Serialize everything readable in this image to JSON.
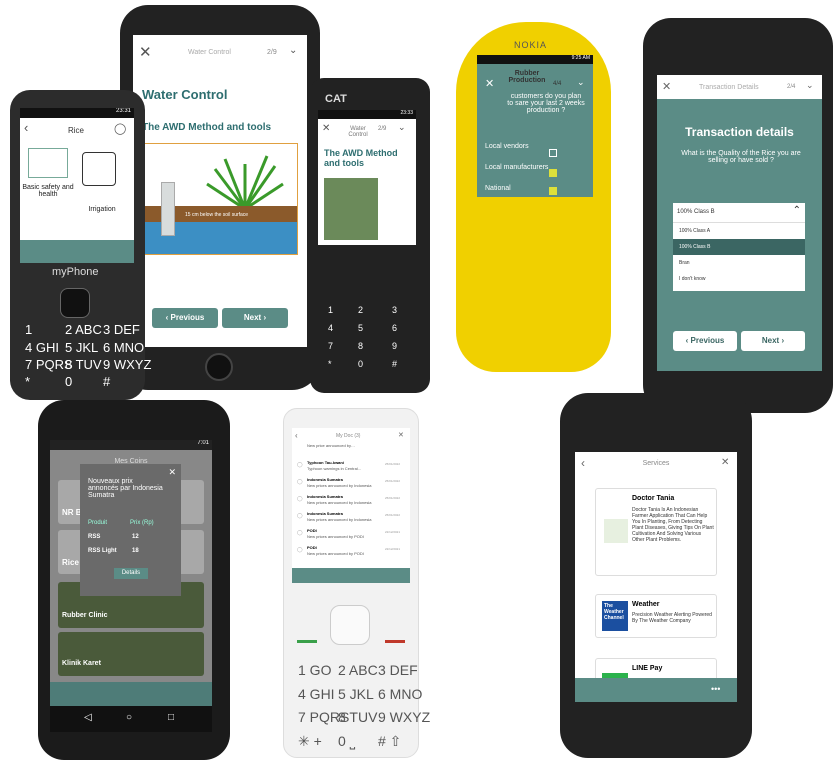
{
  "water": {
    "title": "Water Control",
    "page": "2/9",
    "heading": "Water Control",
    "subheading": "The AWD Method and tools",
    "depth_label": "15 cm below the soil surface",
    "prev": "Previous",
    "next": "Next"
  },
  "myphone": {
    "time": "23:31",
    "app": "Rice",
    "item1": "Basic safety and health",
    "item2": "Irrigation",
    "brand": "myPhone",
    "keys": [
      "1",
      "2 ABC",
      "3 DEF",
      "4 GHI",
      "5 JKL",
      "6 MNO",
      "7 PQRS",
      "8 TUV",
      "9 WXYZ",
      "*",
      "0",
      "#"
    ]
  },
  "cat": {
    "brand": "CAT",
    "time": "23:33",
    "title": "Water Control",
    "page": "2/9",
    "heading": "The AWD Method and tools",
    "keys": [
      "1",
      "2",
      "3",
      "4",
      "5",
      "6",
      "7",
      "8",
      "9",
      "*",
      "0",
      "#"
    ]
  },
  "nokia": {
    "brand": "NOKIA",
    "time": "9:25 AM",
    "title": "Rubber Production",
    "page": "4/4",
    "question": "customers do you plan to sare your last 2 weeks production ?",
    "options": [
      "Local vendors",
      "Local manufacturers",
      "National"
    ]
  },
  "transaction": {
    "title": "Transaction Details",
    "page": "2/4",
    "heading": "Transaction details",
    "question": "What is the Quality of the Rice you are selling or have sold ?",
    "selected": "100% Class B",
    "options": [
      "100% Class A",
      "100% Class B",
      "Bran",
      "I don't know"
    ],
    "prev": "Previous",
    "next": "Next"
  },
  "mycoins": {
    "time": "7:01",
    "title": "Mes Coins",
    "popup_text": "Nouveaux prix annoncés par Indonesia Sumatra",
    "col1": "Produit",
    "col2": "Prix (Rp)",
    "rows": [
      {
        "product": "RSS",
        "price": "12"
      },
      {
        "product": "RSS Light",
        "price": "18"
      }
    ],
    "details": "Details",
    "cards": [
      "NR B",
      "Rice",
      "Rubber Clinic",
      "Klinik Karet"
    ]
  },
  "feature": {
    "title": "My Doc (3)",
    "items": [
      {
        "title": "",
        "sub": "New price announced by…",
        "date": ""
      },
      {
        "title": "Typhoon Tau-kwani",
        "sub": "Typhoon warnings in Central...",
        "date": "25/01/2022"
      },
      {
        "title": "Indonesia Sumatra",
        "sub": "New prices announced by Indonesia",
        "date": "25/01/2022"
      },
      {
        "title": "Indonesia Sumatra",
        "sub": "New prices announced by Indonesia",
        "date": "25/01/2022"
      },
      {
        "title": "Indonesia Sumatra",
        "sub": "New prices announced by Indonesia",
        "date": "25/01/2022"
      },
      {
        "title": "PODI",
        "sub": "New prices announced by PODI",
        "date": "22/12/2021"
      },
      {
        "title": "PODI",
        "sub": "New prices announced by PODI",
        "date": "22/12/2021"
      }
    ],
    "keys": [
      "1 GO",
      "2 ABC",
      "3 DEF",
      "4 GHI",
      "5 JKL",
      "6 MNO",
      "7 PQRS",
      "8 TUV",
      "9 WXYZ",
      "✳ +",
      "0 ⎵",
      "# ⇧"
    ]
  },
  "services": {
    "title": "Services",
    "items": [
      {
        "name": "Doctor Tania",
        "desc": "Doctor Tania Is An Indonesian Farmer Application That Can Help You In Planting, From Detecting Plant Diseases, Giving Tips On Plant Cultivation And Solving Various Other Plant Problems."
      },
      {
        "name": "Weather",
        "desc": "Precision Weather Alerting Powered By The Weather Company",
        "logo": "The Weather Channel"
      },
      {
        "name": "LINE Pay",
        "desc": ""
      }
    ]
  }
}
